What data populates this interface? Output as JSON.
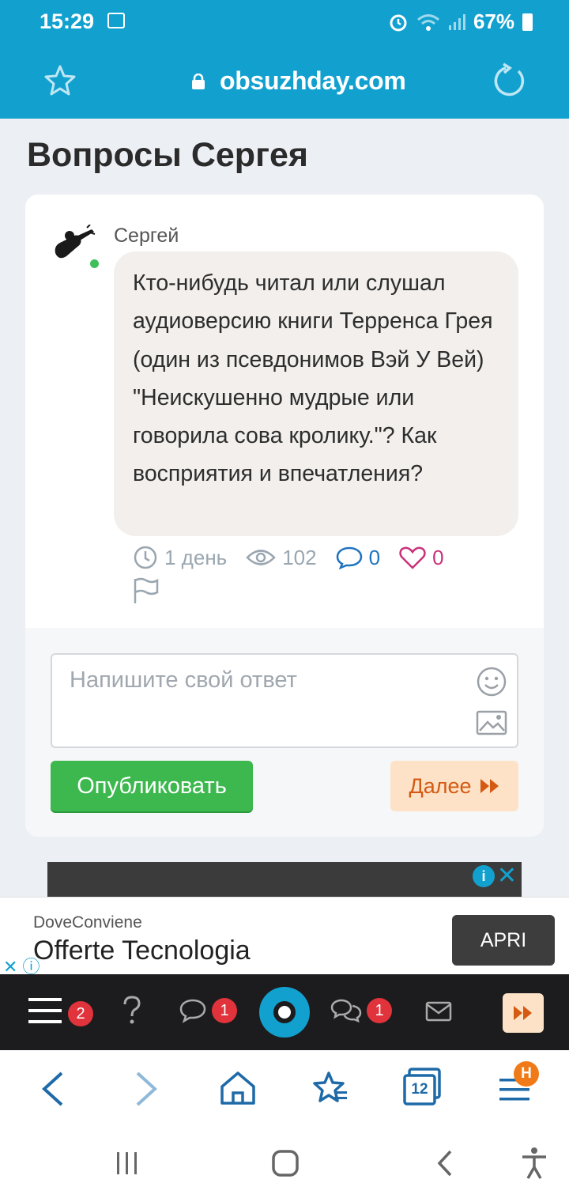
{
  "status_bar": {
    "time": "15:29",
    "battery": "67%"
  },
  "url_bar": {
    "url": "obsuzhday.com"
  },
  "page": {
    "title": "Вопросы Сергея"
  },
  "question": {
    "author": "Сергей",
    "text": "Кто-нибудь читал или слушал аудиоверсию книги Терренса Грея (один из псевдонимов Вэй У Вей) \"Неискушенно мудрые или говорила сова кролику.\"? Как восприятия и впечатления?",
    "time": "1 день",
    "views": "102",
    "comments": "0",
    "likes": "0"
  },
  "reply": {
    "placeholder": "Напишите свой ответ",
    "publish_label": "Опубликовать",
    "next_label": "Далее"
  },
  "ad": {
    "brand": "DoveConviene",
    "title": "Offerte Tecnologia",
    "button": "APRI"
  },
  "site_nav": {
    "menu_badge": "2",
    "messages_badge": "1",
    "chats_badge": "1"
  },
  "browser_nav": {
    "tabs_count": "12",
    "menu_badge": "Н"
  },
  "colors": {
    "brand": "#12a1cf",
    "publish": "#3cb84e",
    "next_bg": "#fde2c7",
    "next_text": "#d45a12",
    "badge": "#e0333b"
  }
}
